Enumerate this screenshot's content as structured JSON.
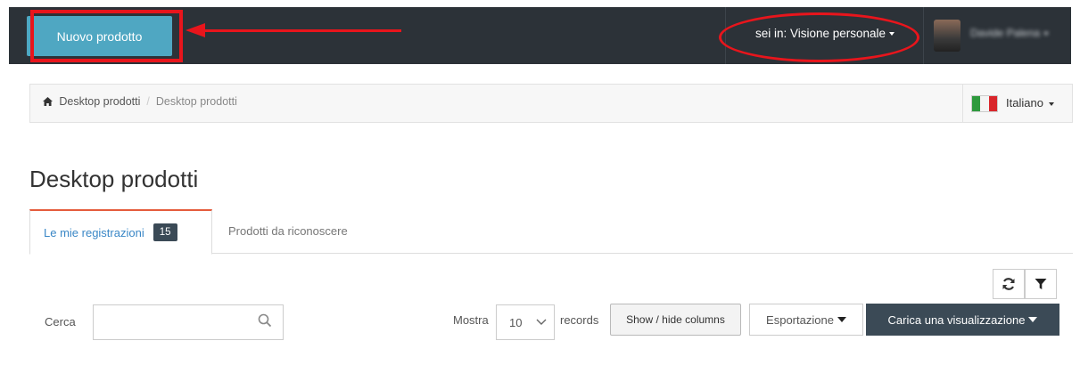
{
  "topbar": {
    "new_product_label": "Nuovo prodotto",
    "context_label": "sei in: Visione personale",
    "user_name": "Davide Palena"
  },
  "breadcrumb": {
    "home": "Desktop prodotti",
    "current": "Desktop prodotti",
    "language": "Italiano"
  },
  "page": {
    "title": "Desktop prodotti"
  },
  "tabs": [
    {
      "label": "Le mie registrazioni",
      "badge": "15",
      "active": true
    },
    {
      "label": "Prodotti da riconoscere",
      "active": false
    }
  ],
  "toolbar": {
    "search_label": "Cerca",
    "search_value": "",
    "show_label": "Mostra",
    "show_value": "10",
    "records_label": "records",
    "columns_button": "Show / hide columns",
    "export_button": "Esportazione",
    "load_view_button": "Carica una visualizzazione"
  },
  "colors": {
    "topbar": "#2c3238",
    "primary_button": "#4fa7c2",
    "annotation_red": "#e8151c",
    "dark_button": "#3b4a56",
    "tab_accent": "#e55c3c",
    "link": "#3a87c6"
  }
}
